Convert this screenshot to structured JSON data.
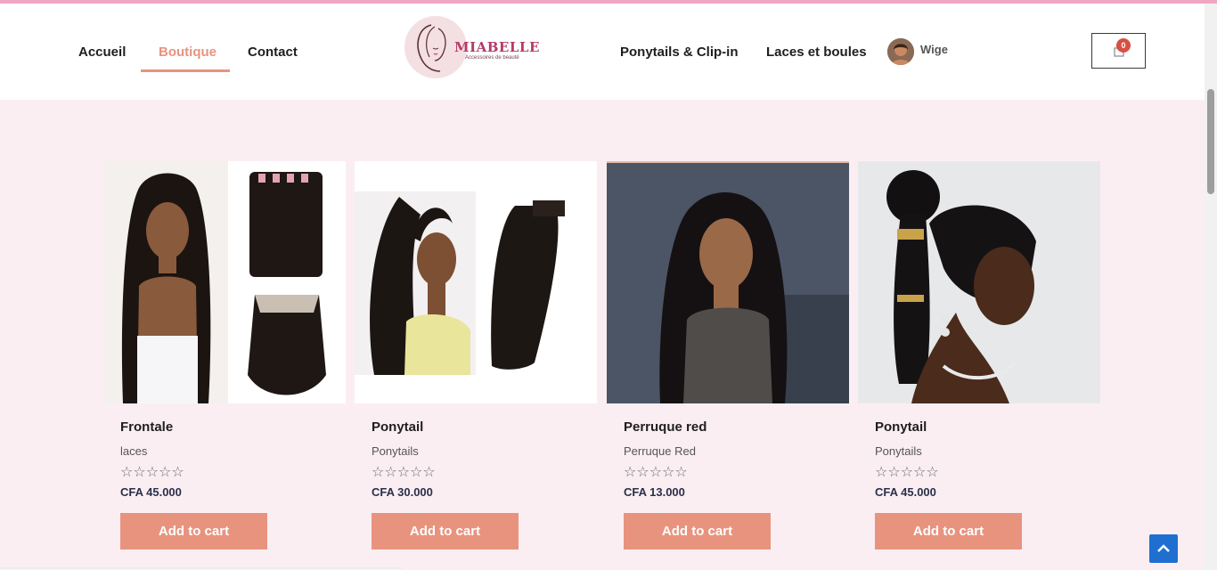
{
  "nav": {
    "home": "Accueil",
    "shop": "Boutique",
    "contact": "Contact",
    "ponytails": "Ponytails & Clip-in",
    "laces": "Laces et boules"
  },
  "brand": {
    "name": "MIABELLE",
    "tagline": "Accessoires de beauté"
  },
  "user": {
    "name": "Wige"
  },
  "cart": {
    "count": "0"
  },
  "products": [
    {
      "title": "Frontale",
      "category": "laces",
      "rating": "☆☆☆☆☆",
      "price": "CFA 45.000",
      "button": "Add to cart"
    },
    {
      "title": "Ponytail",
      "category": "Ponytails",
      "rating": "☆☆☆☆☆",
      "price": "CFA 30.000",
      "button": "Add to cart"
    },
    {
      "title": "Perruque red",
      "category": "Perruque Red",
      "rating": "☆☆☆☆☆",
      "price": "CFA 13.000",
      "button": "Add to cart"
    },
    {
      "title": "Ponytail",
      "category": "Ponytails",
      "rating": "☆☆☆☆☆",
      "price": "CFA 45.000",
      "button": "Add to cart"
    }
  ],
  "colors": {
    "accent": "#e8937e",
    "page_bg": "#fbeef3",
    "brand": "#b73a6a",
    "badge": "#d94f45",
    "back_to_top": "#1f6fd1"
  }
}
